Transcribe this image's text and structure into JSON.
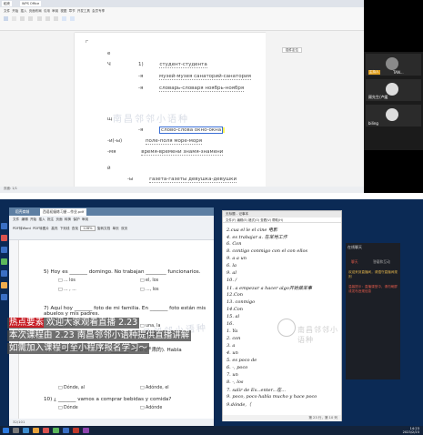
{
  "top_screen": {
    "tabs": [
      "稻壳",
      "WPS Office"
    ],
    "ribbon_menu": [
      "文件",
      "开始",
      "插入",
      "页面布局",
      "引用",
      "审阅",
      "视图",
      "章节",
      "开发工具",
      "会员专享"
    ],
    "side_button": "插件定位",
    "status_text": "页面: 1/1",
    "doc_lines": [
      {
        "prefix": "е",
        "text": ""
      },
      {
        "prefix": "Ч",
        "text": ""
      },
      {
        "prefix": "1)",
        "text": "студент-студента"
      },
      {
        "prefix": "-я",
        "text": "музей-музея   санаторий-санатория"
      },
      {
        "prefix": "-я",
        "text": "словарь-словаря   ноябрь-ноября"
      },
      {
        "prefix": "щ",
        "text": ""
      },
      {
        "prefix": "-я",
        "text": "слово-слова   окно-окна"
      },
      {
        "prefix": "-и(-ы)",
        "text": "поле-поля   море-моря"
      },
      {
        "prefix": "-мя",
        "text": "время-времени   знамя-знамени"
      },
      {
        "prefix": "й",
        "text": ""
      },
      {
        "prefix": "-ы",
        "text": "газета-газеты   девушка-девушки"
      }
    ],
    "watermark": "南昌邻邻小语种",
    "video_tiles": [
      {
        "name": "TAN...",
        "badge": "主持人"
      },
      {
        "name": "顾先生/卢媛",
        "badge": ""
      },
      {
        "name": "biling",
        "badge": ""
      }
    ]
  },
  "bottom_screen": {
    "pdf_tabs": [
      "稻壳商城",
      "西语初级练习册...作业.pdf"
    ],
    "toolbar_row1": [
      "文件",
      "编辑",
      "开始",
      "插入",
      "批注",
      "页面",
      "转换",
      "保护",
      "审阅"
    ],
    "toolbar_row2": [
      "PDF转Word",
      "PDF转图片",
      "高亮",
      "下划线",
      "查找",
      "128%",
      "旋转文档",
      "单页",
      "双页"
    ],
    "exercises": [
      {
        "num": "5)",
        "text": "Hoy es _______ domingo. No trabajan ________ funcionarios.",
        "opts": [
          [
            "□ ... los",
            "□ el, los"
          ],
          [
            "□ ... , ...",
            "□ ..., los"
          ]
        ]
      },
      {
        "num": "7)",
        "text": "Aquí hoy _______ foto de mi familia. En _______ foto están mis abuelos y mis padres.",
        "opts": [
          [
            "□ el, el",
            "□ una, la"
          ],
          [
            "□ ... , ...",
            "□ la, el"
          ]
        ]
      },
      {
        "num": "6)",
        "text": "Mi padre es un hombre _______ serio (严肃的). Habla",
        "opts": [
          [
            "□ Dónde, al",
            "□ Adónde, el"
          ]
        ]
      },
      {
        "num": "10)",
        "text": "¿ _______ vamos a comprar bebidas y comida?",
        "opts": [
          [
            "□ Dónde",
            "□ Adónde"
          ]
        ]
      }
    ],
    "overlay": {
      "line1_tag": "热点要素",
      "line1": "欢迎大家观看直播 2.23",
      "line2": "本次课程由 2.23 南昌邻邻小语种提供直播讲解",
      "line3": "如需加入课程可至小程序报名学习～"
    },
    "pdf_status": "32/101",
    "watermark": "南昌邻邻小语种",
    "notes": {
      "title": "无标题 - 记事本",
      "menu": "文件(F)  编辑(E)  格式(O)  查看(V)  帮助(H)",
      "lines": [
        "2.cua el    le el cine 电影",
        "4. es     trabajar a.  在某地工作",
        "6. Con",
        "8. contigo       conmigo con el con ellos",
        "9. a a un",
        "6. la",
        "9. al",
        "10. /",
        "11. a    empezar a hacer algo开始做某事",
        "12.Con",
        "13. conmigo",
        "14.Con",
        "15. al",
        "16.",
        "1. Ya",
        "2. con",
        "3. a",
        "4. un",
        "5. es  poco de",
        "6. -, poco",
        "7. un",
        "8. -, los",
        "7. salir de   Ev...enter...在...",
        "9. poco, poco      habla mucho y hace poco",
        "9.dónde,（"
      ],
      "status": "第 23 行，第 10 列"
    },
    "chat": {
      "title": "在线聊天",
      "tabs": [
        "聊天",
        "答疑和互动"
      ],
      "messages": [
        {
          "kind": "sys",
          "text": "欢迎来到直播间，请遵守直播间规则"
        },
        {
          "kind": "red",
          "text": "温馨提示：直播课堂中，请勿刷屏或发布违规信息"
        }
      ]
    },
    "clock": {
      "time": "14:23",
      "date": "2023/2/23"
    }
  },
  "colors": {
    "accent_blue": "#3a6fd6",
    "highlight_yellow": "#fff35a",
    "desktop_blue": "#0b2a55",
    "banner_red": "#c81d25"
  }
}
